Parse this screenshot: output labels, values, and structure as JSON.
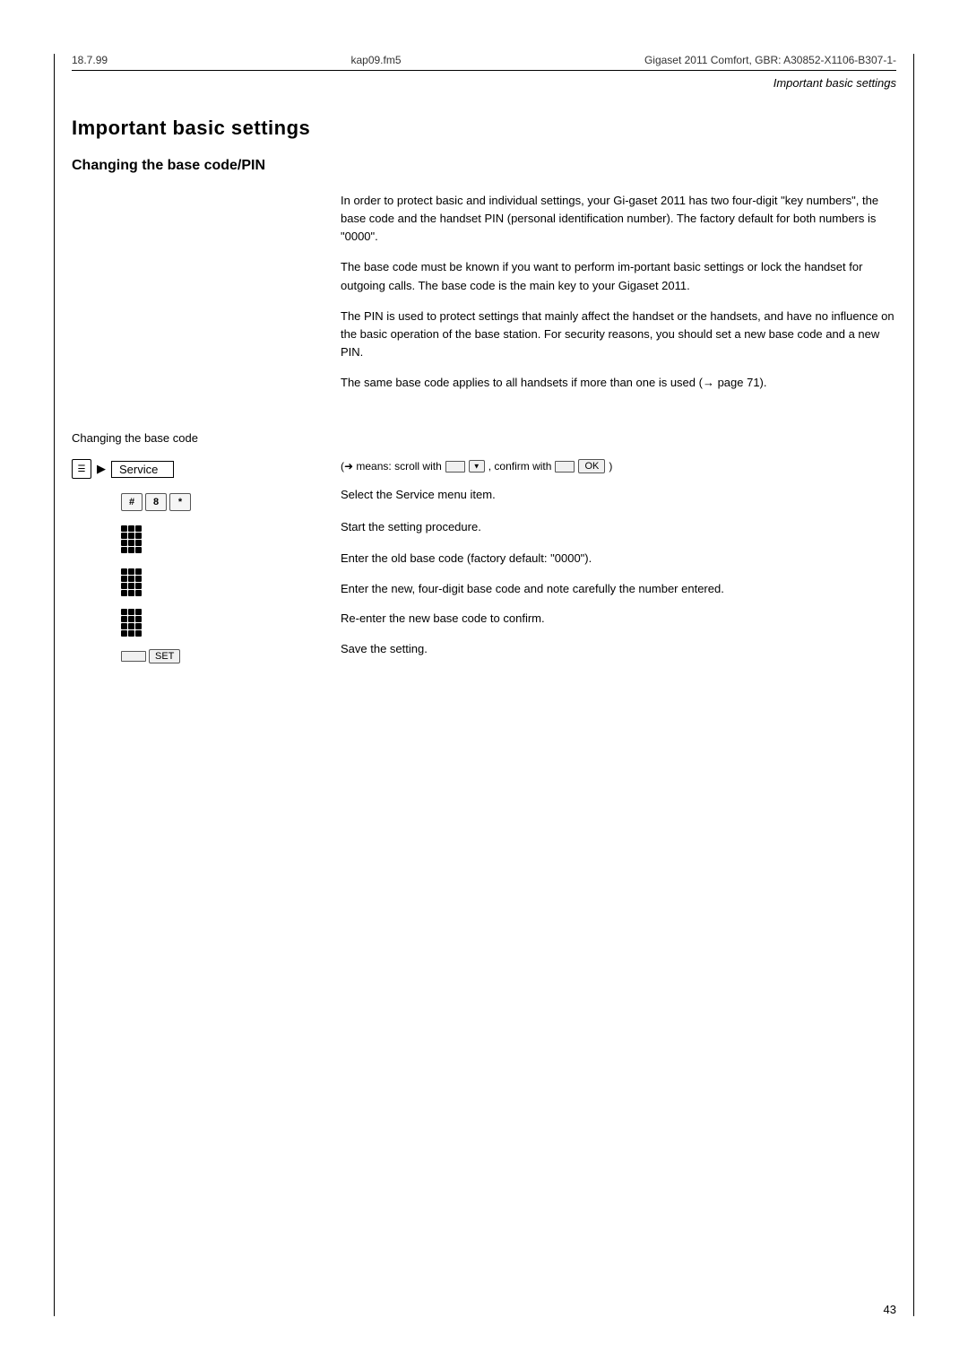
{
  "meta": {
    "date": "18.7.99",
    "file": "kap09.fm5",
    "product": "Gigaset 2011 Comfort, GBR: A30852-X1106-B307-1-",
    "page_number": "43"
  },
  "header": {
    "title": "Important basic settings"
  },
  "page_title": "Important basic settings",
  "section_heading": "Changing the base code/PIN",
  "paragraphs": [
    "In order to protect basic and individual settings, your Gi-gaset 2011 has two four-digit \"key numbers\", the base code and the handset PIN (personal identification number). The factory default for both numbers is \"0000\".",
    "The base code must be known if you want to perform im-portant basic settings or lock the handset for outgoing calls. The base code is the main key to your Gigaset 2011.",
    "The PIN is used to protect settings that mainly affect the handset or the handsets, and have no influence on the basic operation of the base station. For security reasons, you should set a new base code and a new PIN.",
    "The same base code applies to all handsets if more than one is used (→ page 71)."
  ],
  "subsection_label": "Changing the base code",
  "scroll_note": "(➜ means: scroll with",
  "scroll_note2": ", confirm with",
  "steps": [
    {
      "id": 1,
      "icon_type": "menu_service",
      "label": "Service",
      "description": "Select the Service menu item."
    },
    {
      "id": 2,
      "icon_type": "keys_hash_8_star",
      "description": "Start the setting procedure."
    },
    {
      "id": 3,
      "icon_type": "keypad_large",
      "description": "Enter the old base code (factory default: \"0000\")."
    },
    {
      "id": 4,
      "icon_type": "keypad_large",
      "description": "Enter the new, four-digit base code and note carefully the number entered."
    },
    {
      "id": 5,
      "icon_type": "keypad_large",
      "description": "Re-enter the new base code to confirm."
    },
    {
      "id": 6,
      "icon_type": "set_softkey",
      "description": "Save the setting."
    }
  ]
}
